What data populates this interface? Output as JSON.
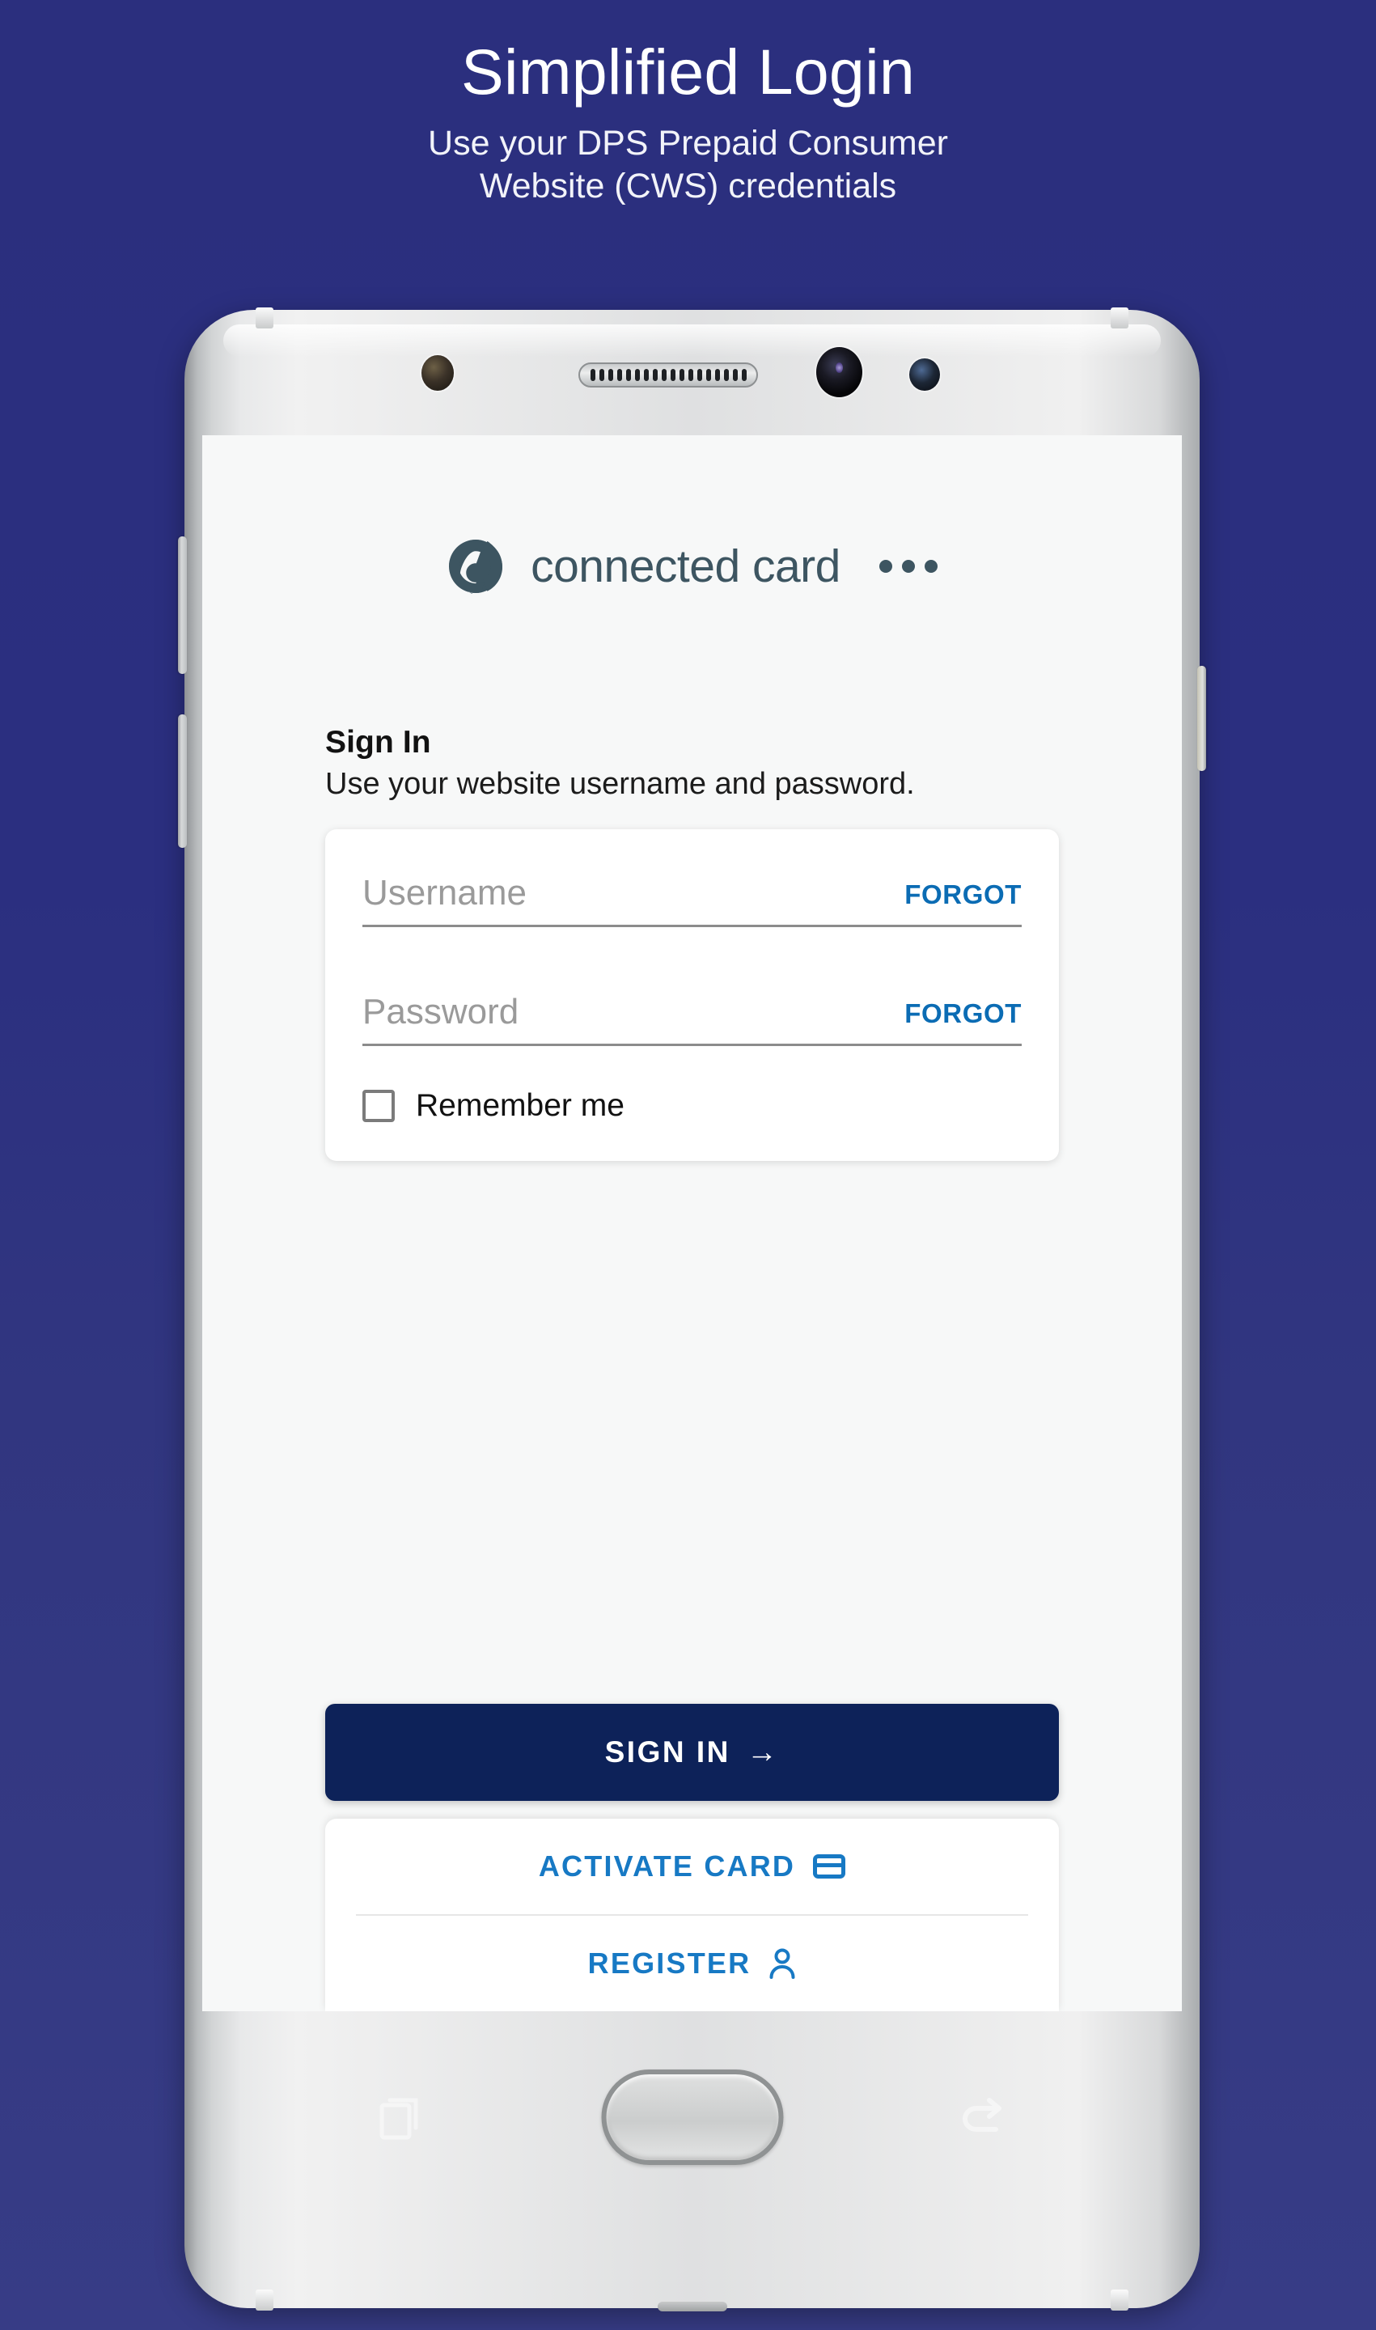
{
  "promo": {
    "title": "Simplified Login",
    "subtitle_line_1": "Use your DPS Prepaid Consumer",
    "subtitle_line_2": "Website (CWS) credentials"
  },
  "colors": {
    "background_top": "#2b2f7e",
    "background_bottom": "#373c86",
    "brand_slate": "#3d5561",
    "primary_navy": "#0d2259",
    "link_blue": "#0b6cb4",
    "action_blue": "#1779c4",
    "screen_bg": "#f7f8f8"
  },
  "app": {
    "brand_name": "connected card",
    "brand_logo_icon": "connected-card-logo-icon",
    "overflow_menu_icon": "overflow-menu-icon"
  },
  "signin": {
    "heading": "Sign In",
    "subheading": "Use your website username and password."
  },
  "form": {
    "username": {
      "placeholder": "Username",
      "value": "",
      "forgot_label": "FORGOT"
    },
    "password": {
      "placeholder": "Password",
      "value": "",
      "forgot_label": "FORGOT"
    },
    "remember_me": {
      "label": "Remember me",
      "checked": false
    }
  },
  "actions": {
    "sign_in": {
      "label": "SIGN IN",
      "icon": "arrow-right-icon",
      "arrow": "→"
    },
    "activate_card": {
      "label": "ACTIVATE CARD",
      "icon": "credit-card-icon"
    },
    "register": {
      "label": "REGISTER",
      "icon": "user-icon"
    }
  },
  "device": {
    "type": "android-phone-mockup",
    "nav": {
      "recents_icon": "recents-icon",
      "home_button": "home-button",
      "back_icon": "back-icon"
    },
    "bezel": {
      "ir_sensor_icon": "ir-sensor-icon",
      "earpiece_speaker_icon": "earpiece-speaker-icon",
      "front_camera_icon": "front-camera-icon",
      "light_sensor_icon": "light-sensor-icon"
    },
    "buttons": {
      "volume_up": "volume-up-button",
      "volume_down": "volume-down-button",
      "power": "power-button"
    }
  }
}
